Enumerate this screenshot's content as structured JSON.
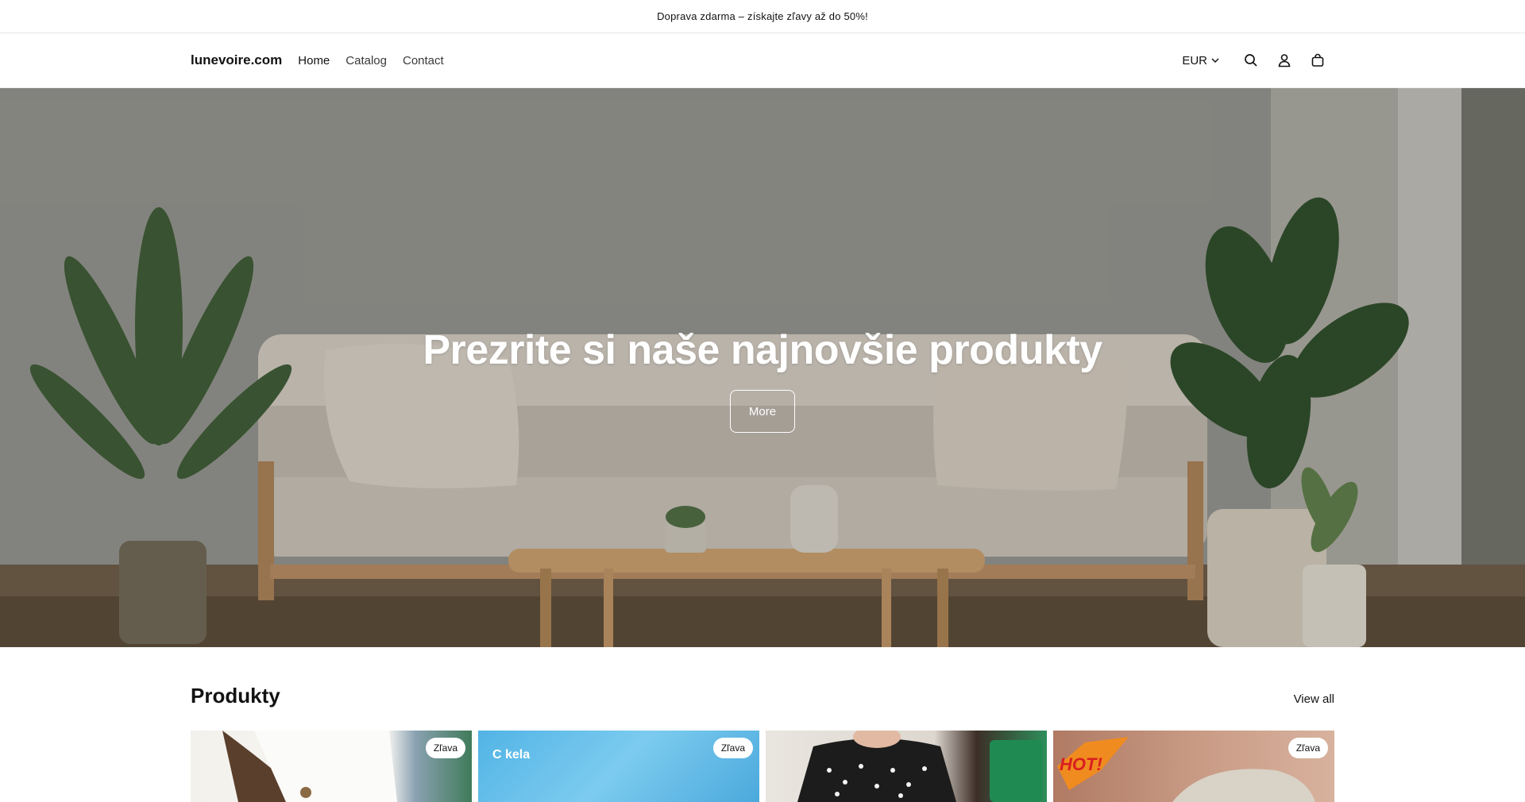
{
  "announcement": {
    "text": "Doprava zdarma – získajte zľavy až do 50%!"
  },
  "header": {
    "logo": "lunevoire.com",
    "nav": [
      {
        "label": "Home"
      },
      {
        "label": "Catalog"
      },
      {
        "label": "Contact"
      }
    ],
    "currency": "EUR",
    "icons": [
      "search-icon",
      "account-icon",
      "cart-icon"
    ]
  },
  "hero": {
    "title": "Prezrite si naše najnovšie produkty",
    "button": "More"
  },
  "products": {
    "title": "Produkty",
    "view_all": "View all",
    "items": [
      {
        "badge": "Zľava"
      },
      {
        "badge": "Zľava",
        "overlay_text": "C kela"
      },
      {
        "badge": ""
      },
      {
        "badge": "Zľava",
        "overlay_text": "HOT!"
      }
    ]
  }
}
